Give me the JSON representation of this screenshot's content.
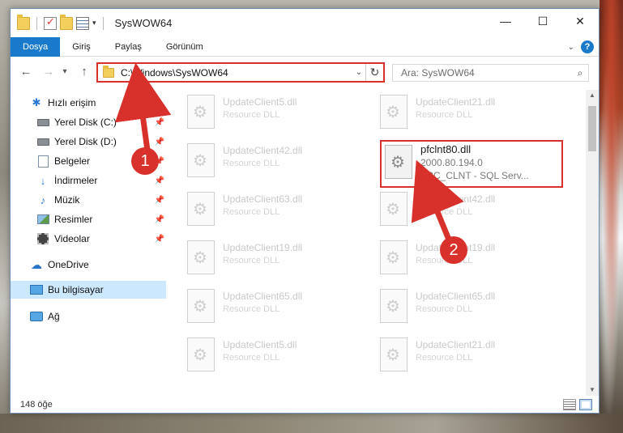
{
  "window": {
    "title": "SysWOW64",
    "controls": {
      "minimize": "—",
      "maximize": "☐",
      "close": "✕"
    }
  },
  "ribbon": {
    "tabs": [
      {
        "label": "Dosya",
        "active": true
      },
      {
        "label": "Giriş"
      },
      {
        "label": "Paylaş"
      },
      {
        "label": "Görünüm"
      }
    ],
    "help": "?"
  },
  "nav": {
    "back": "←",
    "forward": "→",
    "recent": "▾",
    "up": "↑",
    "address": "C:\\Windows\\SysWOW64",
    "address_dropdown": "⌄",
    "refresh": "↻",
    "search_placeholder": "Ara: SysWOW64"
  },
  "sidebar": {
    "items": [
      {
        "label": "Hızlı erişim",
        "icon": "star-icon"
      },
      {
        "label": "Yerel Disk (C:)",
        "icon": "disk-icon",
        "pinned": true
      },
      {
        "label": "Yerel Disk (D:)",
        "icon": "disk-icon",
        "pinned": true
      },
      {
        "label": "Belgeler",
        "icon": "documents-icon",
        "pinned": true
      },
      {
        "label": "İndirmeler",
        "icon": "download-icon",
        "pinned": true
      },
      {
        "label": "Müzik",
        "icon": "music-icon",
        "pinned": true
      },
      {
        "label": "Resimler",
        "icon": "pictures-icon",
        "pinned": true
      },
      {
        "label": "Videolar",
        "icon": "videos-icon",
        "pinned": true
      },
      {
        "label": "OneDrive",
        "icon": "cloud-icon"
      },
      {
        "label": "Bu bilgisayar",
        "icon": "computer-icon",
        "selected": true
      },
      {
        "label": "Ağ",
        "icon": "network-icon"
      }
    ]
  },
  "files": {
    "left": [
      {
        "name": "UpdateClient5.dll",
        "desc": "Resource DLL"
      },
      {
        "name": "UpdateClient42.dll",
        "desc": "Resource DLL"
      },
      {
        "name": "UpdateClient63.dll",
        "desc": "Resource DLL"
      },
      {
        "name": "UpdateClient19.dll",
        "desc": "Resource DLL"
      },
      {
        "name": "UpdateClient65.dll",
        "desc": "Resource DLL"
      },
      {
        "name": "UpdateClient5.dll",
        "desc": "Resource DLL"
      }
    ],
    "right": [
      {
        "name": "UpdateClient21.dll",
        "desc": "Resource DLL"
      },
      {
        "name": "pfclnt80.dll",
        "version": "2000.80.194.0",
        "desc": "TRC_CLNT - SQL Serv...",
        "highlighted": true
      },
      {
        "name": "UpdateClient42.dll",
        "desc": "Resource DLL"
      },
      {
        "name": "UpdateClient19.dll",
        "desc": "Resource DLL"
      },
      {
        "name": "UpdateClient65.dll",
        "desc": "Resource DLL"
      },
      {
        "name": "UpdateClient21.dll",
        "desc": "Resource DLL"
      }
    ]
  },
  "status": {
    "count": "148 öğe"
  },
  "callouts": {
    "one": "1",
    "two": "2"
  },
  "colors": {
    "accent": "#1979ca",
    "highlight": "#d8302a",
    "selected": "#cce8ff"
  }
}
